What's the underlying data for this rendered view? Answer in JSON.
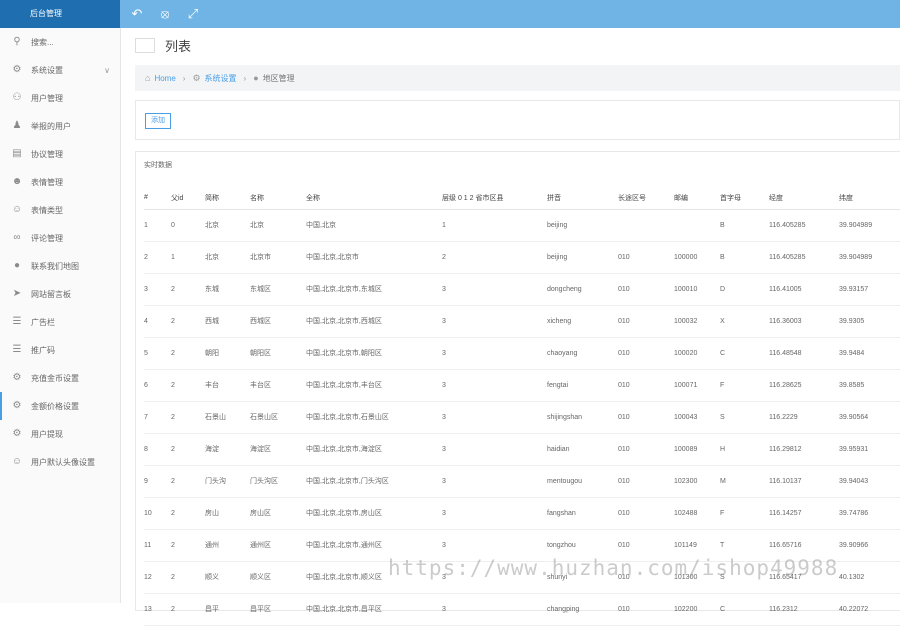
{
  "header": {
    "brand": "后台管理"
  },
  "sidebar": {
    "search_label": "搜索...",
    "items": [
      {
        "label": "系统设置",
        "icon": "gear-icon",
        "expandable": true
      },
      {
        "label": "用户管理",
        "icon": "users-icon"
      },
      {
        "label": "举报的用户",
        "icon": "user-tie-icon"
      },
      {
        "label": "协议管理",
        "icon": "document-icon"
      },
      {
        "label": "表情管理",
        "icon": "emoji-icon"
      },
      {
        "label": "表情类型",
        "icon": "emoji-type-icon"
      },
      {
        "label": "评论管理",
        "icon": "link-icon"
      },
      {
        "label": "联系我们地图",
        "icon": "map-pin-icon"
      },
      {
        "label": "网站留言板",
        "icon": "send-icon"
      },
      {
        "label": "广告栏",
        "icon": "menu-icon"
      },
      {
        "label": "推广码",
        "icon": "menu-icon"
      },
      {
        "label": "充值金币设置",
        "icon": "gear-icon"
      },
      {
        "label": "金额价格设置",
        "icon": "gear-icon",
        "active": true
      },
      {
        "label": "用户提现",
        "icon": "gear-icon"
      },
      {
        "label": "用户默认头像设置",
        "icon": "user-icon"
      }
    ]
  },
  "main": {
    "title": "列表",
    "breadcrumb": {
      "home": "Home",
      "level1": "系统设置",
      "current": "地区管理"
    },
    "add_button": "添加",
    "panel_title": "实时数据"
  },
  "table": {
    "headers": [
      "#",
      "父id",
      "简称",
      "名称",
      "全称",
      "层级 0 1 2 省市区县",
      "拼音",
      "长途区号",
      "邮编",
      "首字母",
      "经度",
      "纬度"
    ],
    "rows": [
      [
        "1",
        "0",
        "北京",
        "北京",
        "中国,北京",
        "1",
        "beijing",
        "",
        "",
        "B",
        "116.405285",
        "39.904989"
      ],
      [
        "2",
        "1",
        "北京",
        "北京市",
        "中国,北京,北京市",
        "2",
        "beijing",
        "010",
        "100000",
        "B",
        "116.405285",
        "39.904989"
      ],
      [
        "3",
        "2",
        "东城",
        "东城区",
        "中国,北京,北京市,东城区",
        "3",
        "dongcheng",
        "010",
        "100010",
        "D",
        "116.41005",
        "39.93157"
      ],
      [
        "4",
        "2",
        "西城",
        "西城区",
        "中国,北京,北京市,西城区",
        "3",
        "xicheng",
        "010",
        "100032",
        "X",
        "116.36003",
        "39.9305"
      ],
      [
        "5",
        "2",
        "朝阳",
        "朝阳区",
        "中国,北京,北京市,朝阳区",
        "3",
        "chaoyang",
        "010",
        "100020",
        "C",
        "116.48548",
        "39.9484"
      ],
      [
        "6",
        "2",
        "丰台",
        "丰台区",
        "中国,北京,北京市,丰台区",
        "3",
        "fengtai",
        "010",
        "100071",
        "F",
        "116.28625",
        "39.8585"
      ],
      [
        "7",
        "2",
        "石景山",
        "石景山区",
        "中国,北京,北京市,石景山区",
        "3",
        "shijingshan",
        "010",
        "100043",
        "S",
        "116.2229",
        "39.90564"
      ],
      [
        "8",
        "2",
        "海淀",
        "海淀区",
        "中国,北京,北京市,海淀区",
        "3",
        "haidian",
        "010",
        "100089",
        "H",
        "116.29812",
        "39.95931"
      ],
      [
        "9",
        "2",
        "门头沟",
        "门头沟区",
        "中国,北京,北京市,门头沟区",
        "3",
        "mentougou",
        "010",
        "102300",
        "M",
        "116.10137",
        "39.94043"
      ],
      [
        "10",
        "2",
        "房山",
        "房山区",
        "中国,北京,北京市,房山区",
        "3",
        "fangshan",
        "010",
        "102488",
        "F",
        "116.14257",
        "39.74786"
      ],
      [
        "11",
        "2",
        "通州",
        "通州区",
        "中国,北京,北京市,通州区",
        "3",
        "tongzhou",
        "010",
        "101149",
        "T",
        "116.65716",
        "39.90966"
      ],
      [
        "12",
        "2",
        "顺义",
        "顺义区",
        "中国,北京,北京市,顺义区",
        "3",
        "shunyi",
        "010",
        "101300",
        "S",
        "116.65417",
        "40.1302"
      ],
      [
        "13",
        "2",
        "昌平",
        "昌平区",
        "中国,北京,北京市,昌平区",
        "3",
        "changping",
        "010",
        "102200",
        "C",
        "116.2312",
        "40.22072"
      ]
    ]
  },
  "watermark": "https://www.huzhan.com/ishop49988"
}
